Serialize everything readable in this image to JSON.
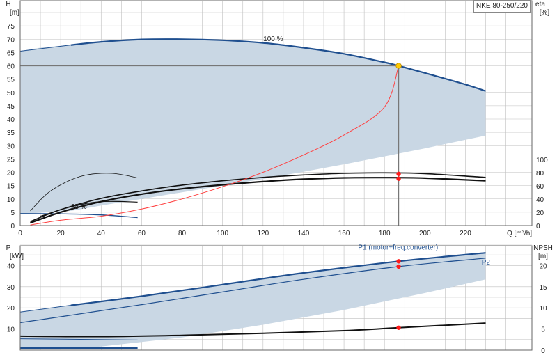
{
  "header": {
    "model": "NKE 80-250/220"
  },
  "colors": {
    "envelope_fill": "#c9d7e4",
    "envelope_fill_light": "#e7eff8",
    "grid": "#bfbfbf",
    "curve_blue": "#1f4f8f",
    "curve_black": "#111111",
    "system_curve_red": "#ff4040",
    "duty_point_yellow": "#ffcc00",
    "duty_point_red": "#ff1a1a",
    "crosshair": "#777777"
  },
  "chart_data": [
    {
      "type": "line",
      "panel": "top",
      "xlabel": "Q [m³/h]",
      "ylabel_left": "H",
      "ylabel_left_unit": "[m]",
      "ylabel_right": "eta",
      "ylabel_right_unit": "[%]",
      "xlim": [
        0,
        270
      ],
      "ylim_left": [
        0,
        80
      ],
      "ylim_right": [
        0,
        320
      ],
      "xticks": [
        0,
        20,
        40,
        60,
        80,
        100,
        120,
        140,
        160,
        180,
        200,
        220
      ],
      "yticks_left": [
        0,
        5,
        10,
        15,
        20,
        25,
        30,
        35,
        40,
        45,
        50,
        55,
        60,
        65,
        70,
        75
      ],
      "yticks_right": [
        0,
        20,
        40,
        60,
        80,
        100
      ],
      "grid": true,
      "annotations": [
        {
          "text": "100 %",
          "x": 125,
          "y": 69.3
        },
        {
          "text": "25 %",
          "x": 29,
          "y": 6.3
        }
      ],
      "series": [
        {
          "role": "envelope",
          "x": [
            0,
            5,
            10,
            15,
            20,
            25,
            40,
            60,
            80,
            100,
            120,
            140,
            160,
            180,
            187,
            200,
            220,
            230,
            230,
            200,
            180,
            160,
            140,
            120,
            100,
            80,
            60,
            40,
            25,
            10,
            5,
            0
          ],
          "y": [
            65.5,
            66.2,
            66.8,
            67.2,
            67.5,
            67.8,
            69.0,
            69.9,
            70.0,
            69.6,
            68.6,
            66.8,
            64.5,
            61.3,
            60.0,
            57.3,
            53.0,
            50.5,
            33.8,
            29.0,
            26.0,
            23.0,
            20.2,
            17.5,
            15.0,
            12.5,
            10.0,
            7.5,
            5.5,
            4.8,
            4.6,
            4.5
          ]
        },
        {
          "role": "max-speed-head",
          "x": [
            0,
            25,
            40,
            60,
            80,
            100,
            120,
            140,
            160,
            180,
            187,
            200,
            220,
            230
          ],
          "y": [
            65.5,
            67.8,
            69.0,
            69.9,
            70.0,
            69.6,
            68.6,
            66.8,
            64.5,
            61.3,
            60.0,
            57.3,
            53.0,
            50.5
          ]
        },
        {
          "role": "system-curve",
          "x": [
            5,
            20,
            40,
            60,
            80,
            100,
            120,
            140,
            160,
            180,
            187
          ],
          "y": [
            0.2,
            2.0,
            3.5,
            6.2,
            10.0,
            14.6,
            20.0,
            26.5,
            34.0,
            44.5,
            60.0
          ]
        },
        {
          "role": "efficiency-upper",
          "x": [
            5,
            20,
            40,
            60,
            80,
            100,
            120,
            140,
            160,
            180,
            200,
            230
          ],
          "y": [
            1.5,
            6.0,
            10.2,
            13.0,
            15.2,
            16.8,
            18.1,
            19.0,
            19.6,
            19.8,
            19.5,
            18.1
          ]
        },
        {
          "role": "efficiency-lower",
          "x": [
            5,
            20,
            40,
            60,
            80,
            100,
            120,
            140,
            160,
            180,
            200,
            230
          ],
          "y": [
            1.0,
            5.0,
            9.0,
            11.8,
            13.8,
            15.3,
            16.5,
            17.4,
            17.9,
            18.0,
            17.8,
            16.8
          ]
        },
        {
          "role": "min-speed-head",
          "x": [
            0,
            20,
            40,
            58
          ],
          "y": [
            4.5,
            4.4,
            4.0,
            3.0
          ]
        },
        {
          "role": "min-speed-eff-a",
          "x": [
            5,
            15,
            30,
            45,
            58
          ],
          "y": [
            5.5,
            13.0,
            18.5,
            19.6,
            17.9
          ]
        },
        {
          "role": "min-speed-eff-b",
          "x": [
            10,
            25,
            40,
            58
          ],
          "y": [
            3.5,
            7.0,
            9.0,
            8.8
          ]
        },
        {
          "role": "duty-crosshair-h",
          "x": [
            0,
            187
          ],
          "y": [
            60,
            60
          ]
        },
        {
          "role": "duty-crosshair-v",
          "x": [
            187,
            187
          ],
          "y": [
            60,
            0
          ]
        }
      ],
      "points": [
        {
          "role": "duty-head",
          "x": 187,
          "y": 60.0
        },
        {
          "role": "duty-eff-a",
          "x": 187,
          "y": 19.4
        },
        {
          "role": "duty-eff-b",
          "x": 187,
          "y": 17.6
        }
      ]
    },
    {
      "type": "line",
      "panel": "bottom",
      "ylabel_left": "P",
      "ylabel_left_unit": "[kW]",
      "ylabel_right": "NPSH",
      "ylabel_right_unit": "[m]",
      "xlim": [
        0,
        270
      ],
      "ylim_left": [
        0,
        50
      ],
      "ylim_right": [
        0,
        25
      ],
      "yticks_left": [
        10,
        20,
        30,
        40
      ],
      "yticks_right": [
        0,
        5,
        10,
        15,
        20
      ],
      "grid": true,
      "legend": [
        {
          "text": "P1 (motor+freq.converter)",
          "x": 167,
          "y": 47.6
        },
        {
          "text": "P2",
          "x": 228,
          "y": 40.4
        }
      ],
      "series": [
        {
          "role": "envelope",
          "x": [
            0,
            20,
            25,
            60,
            100,
            140,
            187,
            230,
            230,
            200,
            160,
            120,
            80,
            40,
            25,
            0
          ],
          "y": [
            18.0,
            20.3,
            21.2,
            25.5,
            31.0,
            36.5,
            42.0,
            46.0,
            33.5,
            27.0,
            19.0,
            12.0,
            6.0,
            1.7,
            0.8,
            0.5
          ]
        },
        {
          "role": "P1",
          "x": [
            0,
            25,
            60,
            100,
            140,
            187,
            230
          ],
          "y": [
            18.0,
            21.2,
            25.5,
            31.0,
            36.5,
            42.0,
            46.0
          ]
        },
        {
          "role": "P2",
          "x": [
            0,
            25,
            60,
            100,
            140,
            187,
            230
          ],
          "y": [
            13.0,
            16.5,
            21.5,
            27.5,
            33.5,
            39.5,
            43.5
          ]
        },
        {
          "role": "NPSH",
          "x": [
            0,
            40,
            80,
            120,
            160,
            187,
            230
          ],
          "y": [
            3.3,
            3.2,
            3.5,
            4.0,
            4.6,
            5.3,
            6.4
          ]
        },
        {
          "role": "min-speed-power",
          "x": [
            0,
            58
          ],
          "y": [
            1.0,
            1.0
          ]
        },
        {
          "role": "min-speed-npsh",
          "x": [
            0,
            58
          ],
          "y": [
            2.7,
            2.4
          ]
        }
      ],
      "points": [
        {
          "role": "duty-P1",
          "x": 187,
          "y": 42.0
        },
        {
          "role": "duty-P2",
          "x": 187,
          "y": 39.5
        },
        {
          "role": "duty-NPSH",
          "x": 187,
          "y": 10.6
        }
      ]
    }
  ]
}
